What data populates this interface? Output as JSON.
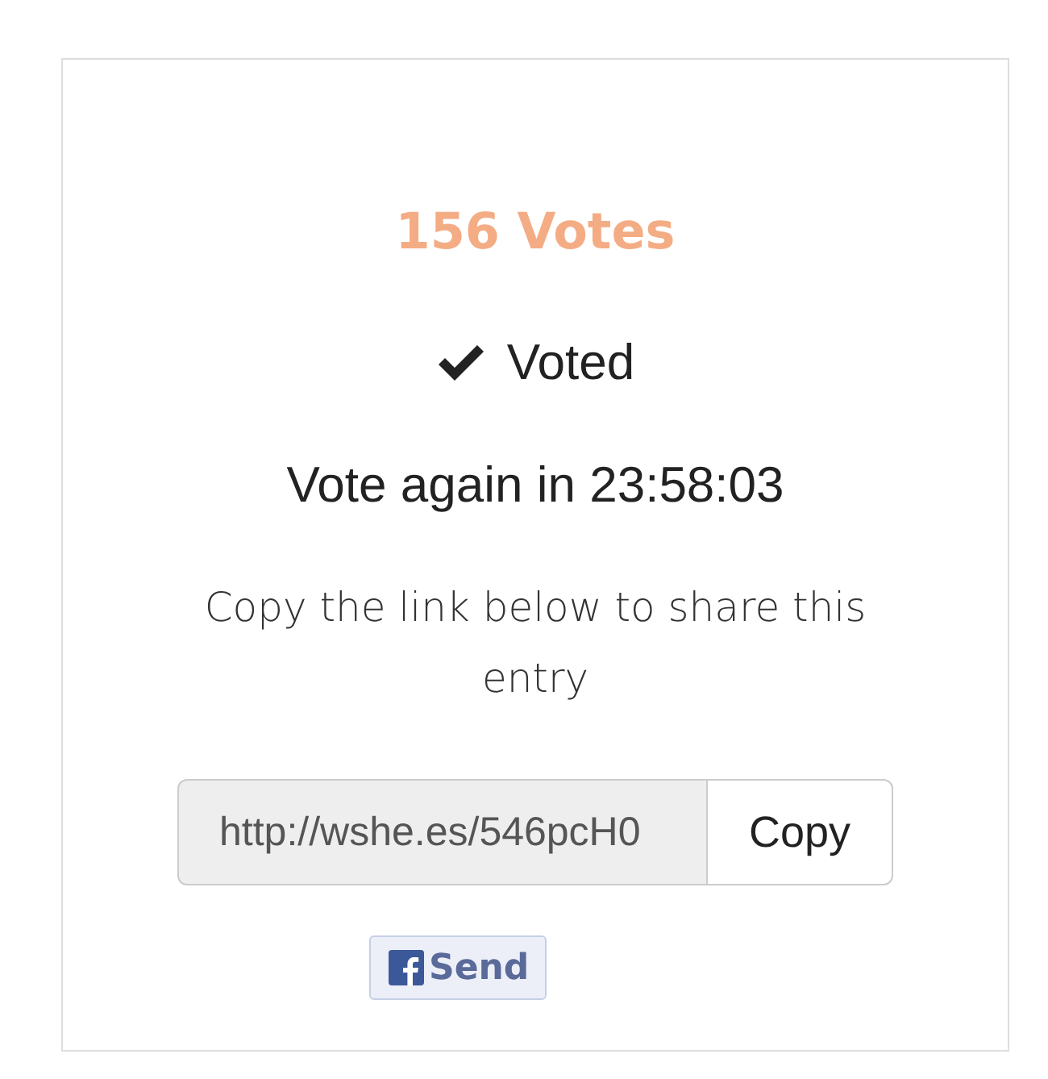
{
  "votes": "156 Votes",
  "status": {
    "voted": true,
    "label": "Voted"
  },
  "countdown": "Vote again in 23:58:03",
  "share_prompt": "Copy the link below to share this entry",
  "link": {
    "value": "http://wshe.es/546pcH0",
    "button": "Copy"
  },
  "facebook_button": "Send"
}
